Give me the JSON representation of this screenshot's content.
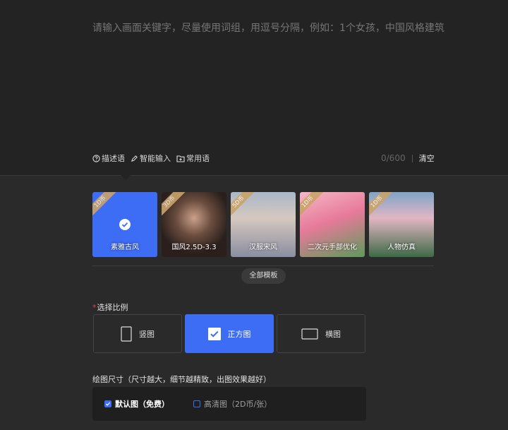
{
  "prompt": {
    "placeholder": "请输入画面关键字，尽量使用词组，用逗号分隔，例如：1个女孩，中国风格建筑",
    "char_count": "0/600",
    "clear_label": "清空"
  },
  "tools": [
    {
      "label": "描述语",
      "icon": "question-circle-icon"
    },
    {
      "label": "智能输入",
      "icon": "pencil-icon"
    },
    {
      "label": "常用语",
      "icon": "folder-plus-icon"
    }
  ],
  "templates": [
    {
      "badge": "1D币",
      "label": "素雅古风",
      "selected": true
    },
    {
      "badge": "3D币",
      "label": "国风2.5D-3.3",
      "selected": false
    },
    {
      "badge": "5D币",
      "label": "汉服宋风",
      "selected": false
    },
    {
      "badge": "1D币",
      "label": "二次元手部优化",
      "selected": false
    },
    {
      "badge": "1D币",
      "label": "人物仿真",
      "selected": false
    }
  ],
  "all_templates_label": "全部模板",
  "ratio_section": {
    "title": "选择比例",
    "options": [
      {
        "label": "竖图",
        "icon": "portrait-rect-icon",
        "selected": false
      },
      {
        "label": "正方图",
        "icon": "checked-square-icon",
        "selected": true
      },
      {
        "label": "横图",
        "icon": "landscape-rect-icon",
        "selected": false
      }
    ]
  },
  "size_section": {
    "title": "绘图尺寸（尺寸越大，细节越精致，出图效果越好）",
    "options": [
      {
        "label": "默认图（免费）",
        "checked": true
      },
      {
        "label": "高清图（2D币/张）",
        "checked": false
      }
    ]
  },
  "colors": {
    "accent": "#3d6cf5",
    "badge": "#caa36a",
    "required": "#e0453c"
  }
}
